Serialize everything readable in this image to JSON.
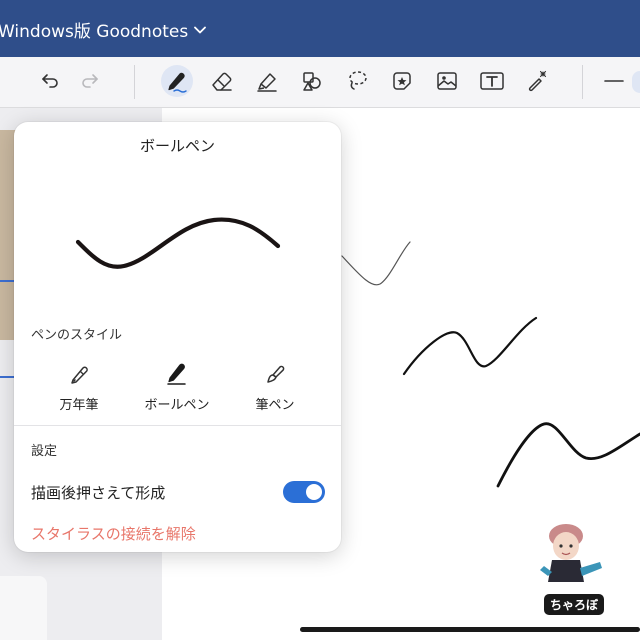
{
  "app": {
    "document_title": "Windows版 Goodnotes",
    "title_chevron_icon": "chevron-down-icon"
  },
  "toolbar": {
    "tools": [
      {
        "name": "undo",
        "icon": "undo-icon"
      },
      {
        "name": "redo",
        "icon": "redo-icon"
      },
      {
        "name": "pen",
        "icon": "pen-icon",
        "active": true
      },
      {
        "name": "eraser",
        "icon": "eraser-icon"
      },
      {
        "name": "highlighter",
        "icon": "highlighter-icon"
      },
      {
        "name": "shapes",
        "icon": "shapes-icon"
      },
      {
        "name": "lasso",
        "icon": "lasso-icon"
      },
      {
        "name": "sticker",
        "icon": "sticker-icon"
      },
      {
        "name": "image",
        "icon": "image-icon"
      },
      {
        "name": "text",
        "icon": "text-box-icon"
      },
      {
        "name": "laser-pointer",
        "icon": "laser-pointer-icon"
      },
      {
        "name": "stroke-width",
        "icon": "stroke-width-icon"
      }
    ]
  },
  "pen_popover": {
    "title": "ボールペン",
    "style_section_label": "ペンのスタイル",
    "pen_styles": [
      {
        "label": "万年筆",
        "icon": "fountain-pen-icon"
      },
      {
        "label": "ボールペン",
        "icon": "ballpoint-pen-icon",
        "selected": true
      },
      {
        "label": "筆ペン",
        "icon": "brush-pen-icon"
      }
    ],
    "settings_section_label": "設定",
    "draw_and_hold_label": "描画後押さえて形成",
    "draw_and_hold_enabled": true,
    "disconnect_stylus_label": "スタイラスの接続を解除"
  },
  "sticker": {
    "label": "ちゃろぼ"
  },
  "colors": {
    "titlebar": "#2f4e8a",
    "accent": "#2b6fd6",
    "danger_text": "#e8766a",
    "ink": "#111111"
  }
}
